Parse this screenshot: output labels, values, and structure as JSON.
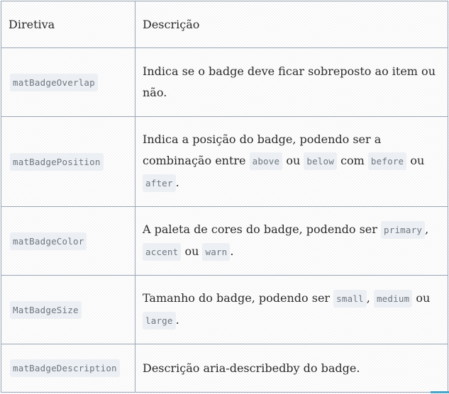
{
  "table": {
    "headers": {
      "directive": "Diretiva",
      "description": "Descrição"
    },
    "rows": [
      {
        "directive": "matBadgeOverlap",
        "text": [
          "Indica se o badge deve ficar sobreposto ao item ou não."
        ]
      },
      {
        "directive": "matBadgePosition",
        "text": [
          "Indica a posição do badge, podendo ser a combinação entre ",
          " ou ",
          " com ",
          " ou ",
          "."
        ],
        "codes": [
          "above",
          "below",
          "before",
          "after"
        ]
      },
      {
        "directive": "matBadgeColor",
        "text": [
          "A paleta de cores do badge, podendo ser ",
          ", ",
          " ou ",
          "."
        ],
        "codes": [
          "primary",
          "accent",
          "warn"
        ]
      },
      {
        "directive": "MatBadgeSize",
        "text": [
          "Tamanho do badge, podendo ser ",
          ", ",
          " ou ",
          "."
        ],
        "codes": [
          "small",
          "medium",
          "large"
        ]
      },
      {
        "directive": "matBadgeDescription",
        "text": [
          "Descrição aria-describedby do badge."
        ]
      }
    ]
  },
  "colors": {
    "border": "#9aa6b6",
    "code_background": "#eceff3",
    "code_text": "#6e7781",
    "body_text": "#2b2b2b",
    "accent": "#4ba3c7"
  }
}
